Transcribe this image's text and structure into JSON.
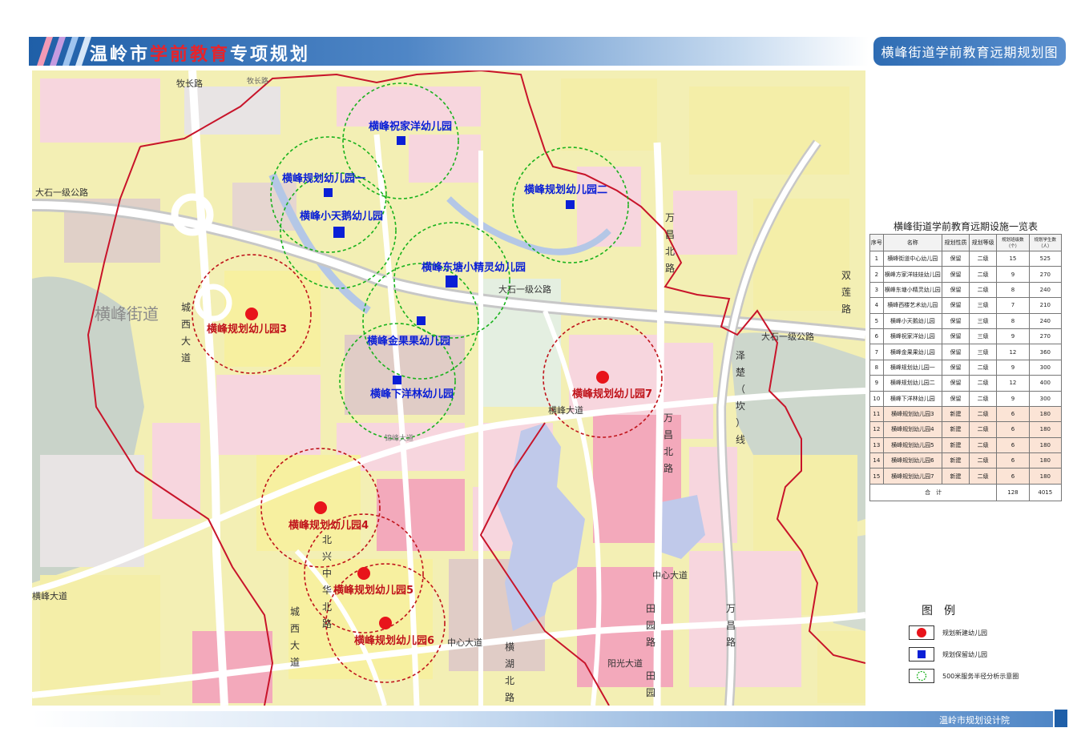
{
  "header": {
    "title_part1": "温岭市",
    "title_part2": "学前教育",
    "title_part3": "专项规划",
    "map_title": "横峰街道学前教育远期规划图"
  },
  "map": {
    "district_label": "横峰街道",
    "roads": [
      {
        "name": "牧长路"
      },
      {
        "name": "牧长路 "
      },
      {
        "name": "大石一级公路"
      },
      {
        "name": "大石一级公路 "
      },
      {
        "name": "大石一级公路  "
      },
      {
        "name": "横峰大道"
      },
      {
        "name": "横峰大道 "
      },
      {
        "name": "中心大道"
      },
      {
        "name": "中心大道 "
      },
      {
        "name": "阳光大道"
      },
      {
        "name": "双莲路"
      },
      {
        "name": "万昌北路"
      },
      {
        "name": "万昌北路 "
      },
      {
        "name": "万昌路"
      },
      {
        "name": "泽楚（坎）线"
      },
      {
        "name": "城西大道"
      },
      {
        "name": "城西大道 "
      },
      {
        "name": "北兴中华北路"
      },
      {
        "name": "横湖北路"
      },
      {
        "name": "田园路"
      },
      {
        "name": "田园"
      },
      {
        "name": "锦峰大道"
      }
    ],
    "schools_retained": [
      {
        "name": "横峰祝家洋幼儿园"
      },
      {
        "name": "横峰规划幼儿园一"
      },
      {
        "name": "横峰小天鹅幼儿园"
      },
      {
        "name": "横峰规划幼儿园二"
      },
      {
        "name": "横峰东塘小精灵幼儿园"
      },
      {
        "name": "横峰金果果幼儿园"
      },
      {
        "name": "横峰下洋林幼儿园"
      }
    ],
    "schools_new": [
      {
        "name": "横峰规划幼儿园3"
      },
      {
        "name": "横峰规划幼儿园7"
      },
      {
        "name": "横峰规划幼儿园4"
      },
      {
        "name": "横峰规划幼儿园5"
      },
      {
        "name": "横峰规划幼儿园6"
      }
    ],
    "colors": {
      "retained": "#0a1fd6",
      "new": "#e8141b",
      "retained_circle": "#19b21c",
      "new_circle": "#c0141b",
      "boundary": "#c8142a"
    }
  },
  "table": {
    "title": "横峰街道学前教育远期设施一览表",
    "headers": [
      "序号",
      "名称",
      "规划性质",
      "规划等级",
      "规划班级数（个）",
      "规划学生数（人）"
    ],
    "rows": [
      [
        "1",
        "横峰街道中心幼儿园",
        "保留",
        "二级",
        "15",
        "525"
      ],
      [
        "2",
        "横峰方家洋娃娃幼儿园",
        "保留",
        "二级",
        "9",
        "270"
      ],
      [
        "3",
        "横峰东塘小精灵幼儿园",
        "保留",
        "二级",
        "8",
        "240"
      ],
      [
        "4",
        "横峰西楼艺术幼儿园",
        "保留",
        "三级",
        "7",
        "210"
      ],
      [
        "5",
        "横峰小天鹅幼儿园",
        "保留",
        "三级",
        "8",
        "240"
      ],
      [
        "6",
        "横峰祝家洋幼儿园",
        "保留",
        "三级",
        "9",
        "270"
      ],
      [
        "7",
        "横峰金果果幼儿园",
        "保留",
        "三级",
        "12",
        "360"
      ],
      [
        "8",
        "横峰规划幼儿园一",
        "保留",
        "二级",
        "9",
        "300"
      ],
      [
        "9",
        "横峰规划幼儿园二",
        "保留",
        "二级",
        "12",
        "400"
      ],
      [
        "10",
        "横峰下洋林幼儿园",
        "保留",
        "二级",
        "9",
        "300"
      ],
      [
        "11",
        "横峰规划幼儿园3",
        "新建",
        "二级",
        "6",
        "180"
      ],
      [
        "12",
        "横峰规划幼儿园4",
        "新建",
        "二级",
        "6",
        "180"
      ],
      [
        "13",
        "横峰规划幼儿园5",
        "新建",
        "二级",
        "6",
        "180"
      ],
      [
        "14",
        "横峰规划幼儿园6",
        "新建",
        "二级",
        "6",
        "180"
      ],
      [
        "15",
        "横峰规划幼儿园7",
        "新建",
        "二级",
        "6",
        "180"
      ]
    ],
    "total": {
      "label": "合　计",
      "classes": "128",
      "students": "4015"
    }
  },
  "legend": {
    "title": "图例",
    "new_label": "规划新建幼儿园",
    "retained_label": "规划保留幼儿园",
    "circle_label": "500米服务半径分析示意圈"
  },
  "footer": {
    "institute": "温岭市规划设计院"
  }
}
